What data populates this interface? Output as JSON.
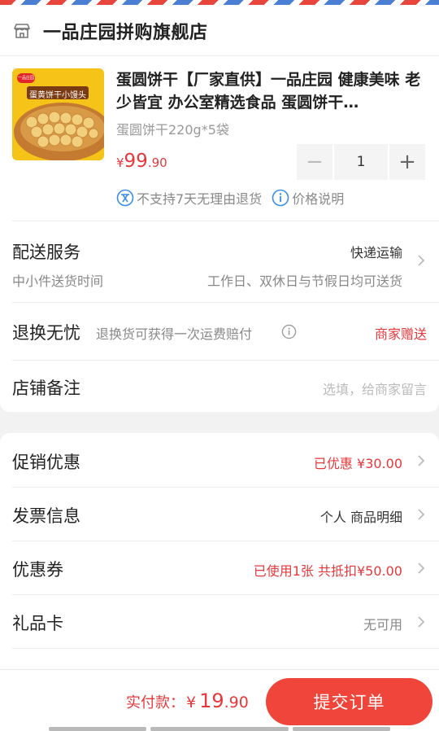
{
  "shop": {
    "name": "一品庄园拼购旗舰店",
    "icon": "store-icon"
  },
  "product": {
    "title": "蛋圆饼干【厂家直供】一品庄园 健康美味 老少皆宜 办公室精选食品 蛋圆饼干…",
    "spec": "蛋圆饼干220g*5袋",
    "price_currency": "¥",
    "price_int": "99",
    "price_dec": ".90",
    "quantity": "1",
    "minus": "−",
    "plus": "+",
    "image_label": "蛋黄饼干小馒头",
    "image_badge": "一品庄园"
  },
  "notices": {
    "no_return": "不支持7天无理由退货",
    "price_info": "价格说明"
  },
  "delivery": {
    "title": "配送服务",
    "method": "快递运输",
    "sub": "中小件送货时间",
    "schedule": "工作日、双休日与节假日均可送货"
  },
  "return_insurance": {
    "title": "退换无忧",
    "desc": "退换货可获得一次运费赔付",
    "value": "商家赠送"
  },
  "remark": {
    "title": "店铺备注",
    "placeholder": "选填，给商家留言"
  },
  "promotion": {
    "title": "促销优惠",
    "value": "已优惠 ¥30.00"
  },
  "invoice": {
    "title": "发票信息",
    "value": "个人 商品明细"
  },
  "coupon": {
    "title": "优惠券",
    "value": "已使用1张 共抵扣¥50.00"
  },
  "giftcard": {
    "title": "礼品卡",
    "value": "无可用"
  },
  "bottom": {
    "pay_label": "实付款：",
    "pay_currency": "¥",
    "pay_int": "19",
    "pay_dec": ".90",
    "submit": "提交订单"
  },
  "colors": {
    "accent": "#e4393c",
    "button": "#f0453a"
  }
}
